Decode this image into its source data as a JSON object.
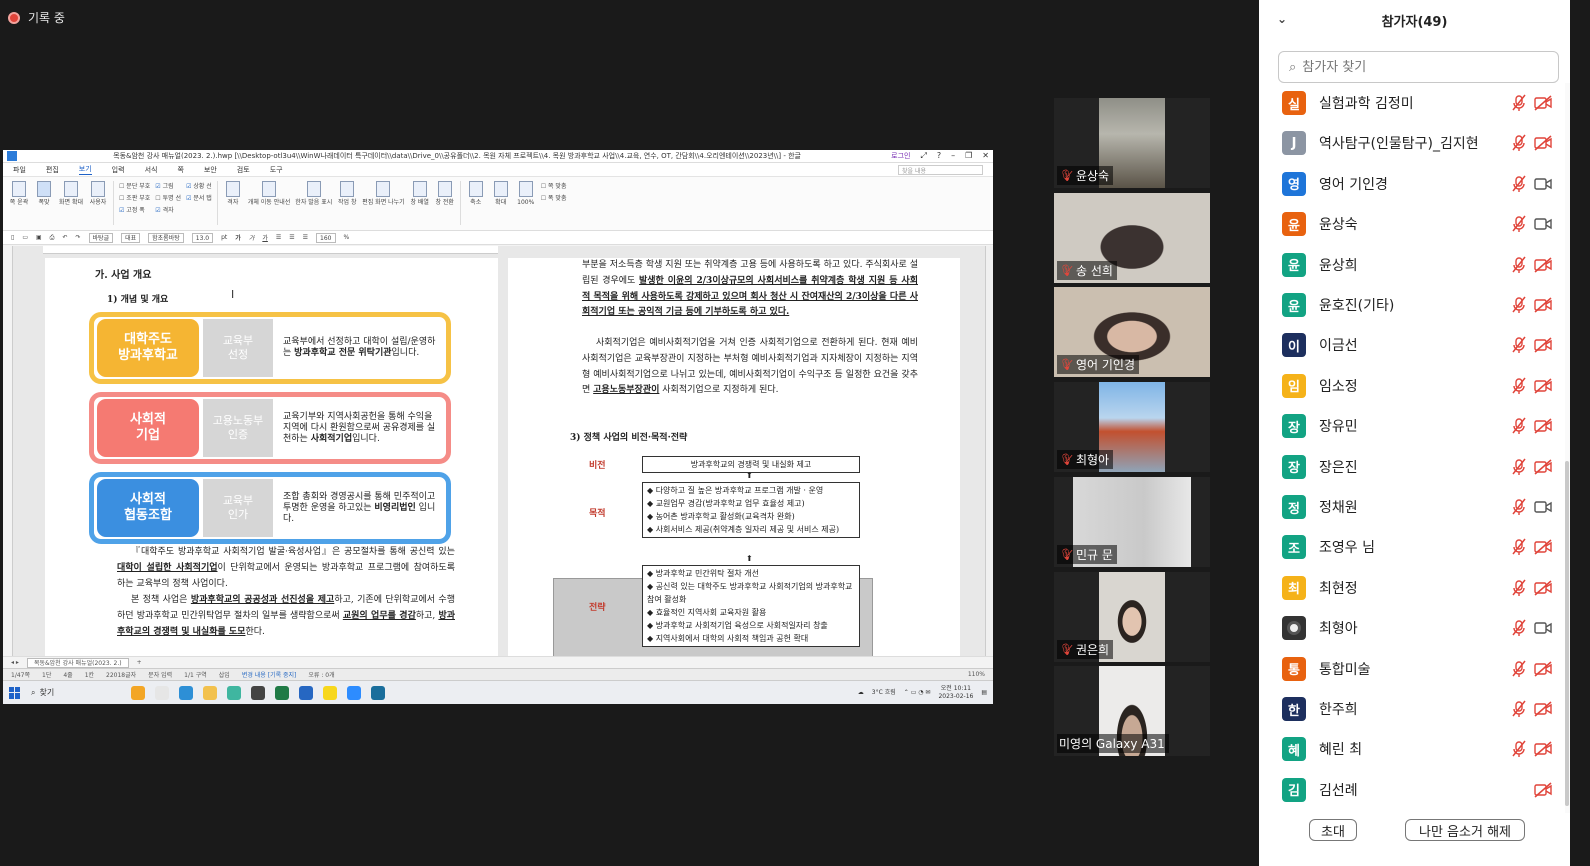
{
  "recording": {
    "label": "기록 중"
  },
  "shared_screen": {
    "window_title": "목동&암천 강사 매뉴얼(2023. 2.).hwp [\\\\Desktop-otl3u4\\\\WinW나래데이터 특구데이터\\\\data\\\\Drive_0\\\\공유폴더\\\\2. 목원 자체 프로젝트\\\\4. 목원 방과후학교 사업\\\\4.교육, 연수, OT, 간담회\\\\4.오리엔테이션\\\\2023년\\\\] - 한글",
    "login_label": "로그인",
    "menu": [
      "파일",
      "편집",
      "보기",
      "입력",
      "서식",
      "쪽",
      "보안",
      "검토",
      "도구"
    ],
    "menu_selected": "보기",
    "search_placeholder": "찾을 내용",
    "ribbon": {
      "buttons1": [
        "쪽 윤곽",
        "폭맞",
        "화면 확대",
        "사용자"
      ],
      "col1": [
        "문단 부호",
        "조판 부호",
        "고정 폭"
      ],
      "col2": [
        "그림",
        "투명 선",
        "격자"
      ],
      "col3": [
        "상황 선",
        "문서 탭"
      ],
      "buttons2": [
        "격자",
        "개체 이동 안내선",
        "한자 발음 표시",
        "작업 창",
        "편집 화면 나누기",
        "창 배열",
        "창 전환"
      ],
      "zoom_out": "축소",
      "zoom_in": "확대",
      "zoom_pct": "100%",
      "opts": [
        "쪽 맞춤",
        "폭 맞춤"
      ]
    },
    "format": {
      "style": "바탕글",
      "font_kind": "대표",
      "font": "함초롬바탕",
      "size": "13.0",
      "unit": "pt",
      "zoom": "160",
      "pct": "%"
    },
    "page1": {
      "heading": "가. 사업 개요",
      "subheading": "1) 개념 및 개요",
      "cards": [
        {
          "label": "대학주도\n방과후학교",
          "sub": "교육부\n선정",
          "desc_pre": "교육부에서 선정하고 대학이 설립/운영하는 ",
          "desc_bold": "방과후학교 전문 위탁기관",
          "desc_post": "입니다."
        },
        {
          "label": "사회적\n기업",
          "sub": "고용노동부\n인증",
          "desc_pre": "교육기부와 지역사회공헌을 통해 수익을 지역에 다시 환원함으로써 공유경제를 실천하는 ",
          "desc_bold": "사회적기업",
          "desc_post": "입니다."
        },
        {
          "label": "사회적\n협동조합",
          "sub": "교육부\n인가",
          "desc_pre": "조합 총회와 경영공시를 통해 민주적이고 투명한 운영을 하고있는 ",
          "desc_bold": "비영리법인",
          "desc_post": " 입니다."
        }
      ],
      "para1": [
        "『대학주도 방과후학교 사회적기업 발굴·육성사업』은 공모절차를 통해 공신력 있는 ",
        "대학이 설립한 사회적기업",
        "이 단위학교에서 운영되는 방과후학교 프로그램에 참여하도록 하는 교육부의 정책 사업이다."
      ],
      "para2": [
        "본 정책 사업은 ",
        "방과후학교의 공공성과 선진성을 제고",
        "하고, 기존에 단위학교에서 수행하던 방과후학교 민간위탁업무 절차의 일부를 생략함으로써 ",
        "교원의 업무를 경감",
        "하고, ",
        "방과후학교의 경쟁력 및 내실화를 도모",
        "한다."
      ]
    },
    "page2": {
      "para1": [
        "부분을 저소득층 학생 지원 또는 취약계층 고용 등에 사용하도록 하고 있다. 주식회사로 설립된 경우에도 ",
        "발생한 이윤의 2/3이상규모의 사회서비스를 취약계층 학생 지원 등 사회적 목적을 위해 사용하도록 강제하고 있으며 회사 청산 시 잔여재산의 2/3이상을 다른 사회적기업 또는 공익적 기금 등에 기부하도록 하고 있다.",
        ""
      ],
      "para2": [
        "사회적기업은 예비사회적기업을 거쳐 인증 사회적기업으로 전환하게 된다. 현재 예비사회적기업은 교육부장관이 지정하는 부처형 예비사회적기업과 지자체장이 지정하는 지역형 예비사회적기업으로 나뉘고 있는데, 예비사회적기업이 수익구조 등 일정한 요건을 갖추면 ",
        "고용노동부장관이",
        " 사회적기업으로 지정하게 된다."
      ],
      "section": "3) 정책 사업의 비전·목적·전략",
      "vision_label": "비전",
      "vision": "방과후학교의 경쟁력 및 내실화 제고",
      "purpose_label": "목적",
      "purpose": [
        "◆ 다양하고 질 높은 방과후학교 프로그램 개발 · 운영",
        "◆ 교원업무 경감(방과후학교 업무 효율성 제고)",
        "◆ 농어촌 방과후학교 활성화(교육격차 완화)",
        "◆ 사회서비스 제공(취약계층 일자리 제공 및 서비스 제공)"
      ],
      "strategy_label": "전략",
      "strategy": [
        "◆ 방과후학교 민간위탁 절차 개선",
        "◆ 공신력 있는 대학주도 방과후학교 사회적기업의 방과후학교 참여 활성화",
        "◆ 효율적인 지역사회 교육자원 활용",
        "◆ 방과후학교 사회적기업 육성으로 사회적일자리 창출",
        "◆ 지역사회에서 대학의 사회적 책임과 공헌 확대"
      ]
    },
    "status": {
      "tab": "목동&암천 강사 매뉴얼(2023. 2.)",
      "page": "1/47쪽",
      "section": "1단",
      "line": "4줄",
      "col": "1칸",
      "chars": "22018글자",
      "mode": "문자 입력",
      "section2": "1/1 구역",
      "insert": "삽입",
      "track": "변경 내용 [기록 중지]",
      "errors": "오류 : 0개",
      "zoom": "110%"
    },
    "taskbar": {
      "search": "찾기",
      "weather": "3°C 흐림",
      "time": "오전 10:11",
      "date": "2023-02-16"
    }
  },
  "video_tiles": [
    {
      "name": "윤상숙",
      "muted": true
    },
    {
      "name": "송 선희",
      "muted": true
    },
    {
      "name": "영어 기인경",
      "muted": true
    },
    {
      "name": "최형아",
      "muted": true
    },
    {
      "name": "민규 문",
      "muted": true
    },
    {
      "name": "권은희",
      "muted": true
    },
    {
      "name": "미영의 Galaxy A31",
      "muted": false
    }
  ],
  "participants_panel": {
    "title": "참가자(49)",
    "search_placeholder": "참가자 찾기",
    "participants": [
      {
        "initial": "실",
        "name": "실험과학 김정미",
        "color": "#e8620f",
        "cam_on": false,
        "mic": true
      },
      {
        "initial": "J",
        "name": "역사탐구(인물탐구)_김지현",
        "color": "#8c95a3",
        "cam_on": false,
        "mic": true
      },
      {
        "initial": "영",
        "name": "영어 기인경",
        "color": "#1e75d9",
        "cam_on": true,
        "mic": true
      },
      {
        "initial": "윤",
        "name": "윤상숙",
        "color": "#e8620f",
        "cam_on": true,
        "mic": true
      },
      {
        "initial": "윤",
        "name": "윤상희",
        "color": "#12a383",
        "cam_on": false,
        "mic": true
      },
      {
        "initial": "윤",
        "name": "윤호진(기타)",
        "color": "#12a383",
        "cam_on": false,
        "mic": true
      },
      {
        "initial": "이",
        "name": "이금선",
        "color": "#1d2f5e",
        "cam_on": false,
        "mic": true
      },
      {
        "initial": "임",
        "name": "임소정",
        "color": "#f5b219",
        "cam_on": false,
        "mic": true
      },
      {
        "initial": "장",
        "name": "장유민",
        "color": "#12a383",
        "cam_on": false,
        "mic": true
      },
      {
        "initial": "장",
        "name": "장은진",
        "color": "#12a383",
        "cam_on": false,
        "mic": true
      },
      {
        "initial": "정",
        "name": "정채원",
        "color": "#12a383",
        "cam_on": true,
        "mic": true
      },
      {
        "initial": "조",
        "name": "조영우 님",
        "color": "#12a383",
        "cam_on": false,
        "mic": true
      },
      {
        "initial": "최",
        "name": "최현정",
        "color": "#f5b219",
        "cam_on": false,
        "mic": true
      },
      {
        "initial": "",
        "name": "최형아",
        "color": "#333333",
        "cam_on": true,
        "mic": true
      },
      {
        "initial": "통",
        "name": "통합미술",
        "color": "#e8620f",
        "cam_on": false,
        "mic": true
      },
      {
        "initial": "한",
        "name": "한주희",
        "color": "#1d2f5e",
        "cam_on": false,
        "mic": true
      },
      {
        "initial": "혜",
        "name": "혜린 최",
        "color": "#12a383",
        "cam_on": false,
        "mic": true
      },
      {
        "initial": "김",
        "name": "김선례",
        "color": "#12a383",
        "cam_on": false,
        "mic": false
      }
    ],
    "invite_label": "초대",
    "unmute_self_label": "나만 음소거 해제"
  }
}
